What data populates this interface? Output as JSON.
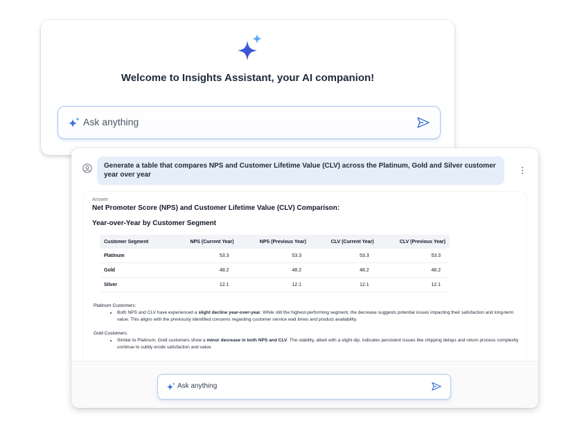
{
  "welcome": {
    "title": "Welcome to Insights Assistant, your AI companion!",
    "ask_placeholder": "Ask anything"
  },
  "chat": {
    "user_message": "Generate a table that compares NPS and Customer Lifetime Value (CLV) across the Platinum, Gold and Silver customer year over year",
    "answer_label": "Answer",
    "answer_title": "Net Promoter Score (NPS) and Customer Lifetime Value (CLV) Comparison:",
    "answer_subtitle": "Year-over-Year by Customer Segment",
    "table": {
      "headers": [
        "Customer Segment",
        "NPS (Current Year)",
        "NPS (Previous Year)",
        "CLV (Current Year)",
        "CLV (Previous Year)"
      ],
      "rows": [
        [
          "Platinum",
          "53.3",
          "53.3",
          "53.3",
          "53.3"
        ],
        [
          "Gold",
          "48.2",
          "48.2",
          "48.2",
          "48.2"
        ],
        [
          "Silver",
          "12.1",
          "12.1",
          "12.1",
          "12.1"
        ]
      ]
    },
    "notes": {
      "platinum": {
        "heading": "Platinum Customers:",
        "pre": "Both NPS and CLV have experienced a ",
        "bold": "slight decline year-over-year",
        "post": ". While still the highest-performing segment, the decrease suggests potential issues impacting their satisfaction and long-term value. This aligns with the previously identified concerns regarding customer service wait times and product availability."
      },
      "gold": {
        "heading": "Gold Customers:",
        "pre": "Similar to Platinum, Gold customers show a ",
        "bold": "minor decrease in both NPS and CLV",
        "post": ". The stability, albeit with a slight dip, indicates persistent issues like shipping delays and return process complexity continue to subtly erode satisfaction and value."
      }
    },
    "ask_placeholder": "Ask anything"
  },
  "colors": {
    "accent": "#3b6fd8",
    "accent_light": "#5aa7f0",
    "bubble": "#e6eef9",
    "input_border": "#a9c4ef"
  },
  "icons": {
    "logo": "sparkle-stars-icon",
    "spark": "sparkle-icon",
    "send": "send-icon",
    "avatar": "user-avatar-icon",
    "menu": "kebab-menu-icon"
  }
}
